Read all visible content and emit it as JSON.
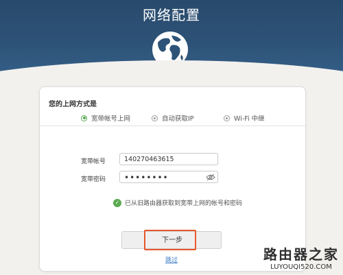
{
  "header": {
    "title": "网络配置",
    "icon": "globe-icon"
  },
  "card": {
    "question": "您的上网方式是",
    "options": [
      {
        "label": "宽带帐号上网",
        "selected": true
      },
      {
        "label": "自动获取IP",
        "selected": false
      },
      {
        "label": "Wi-Fi 中继",
        "selected": false
      }
    ],
    "account": {
      "label": "宽带帐号",
      "value": "140270463615"
    },
    "password": {
      "label": "宽带密码",
      "value": "••••••••"
    },
    "hint": "已从旧路由器获取到宽带上网的帐号和密码",
    "next_button": "下一步",
    "skip_link": "跳过"
  },
  "watermark": {
    "chinese": "路由器之家",
    "domain": "LUYOUQI520.COM"
  },
  "colors": {
    "header": "#2e5378",
    "accent_green": "#5aaa50",
    "highlight_orange": "#e8572a",
    "link_blue": "#3e7dc5"
  }
}
